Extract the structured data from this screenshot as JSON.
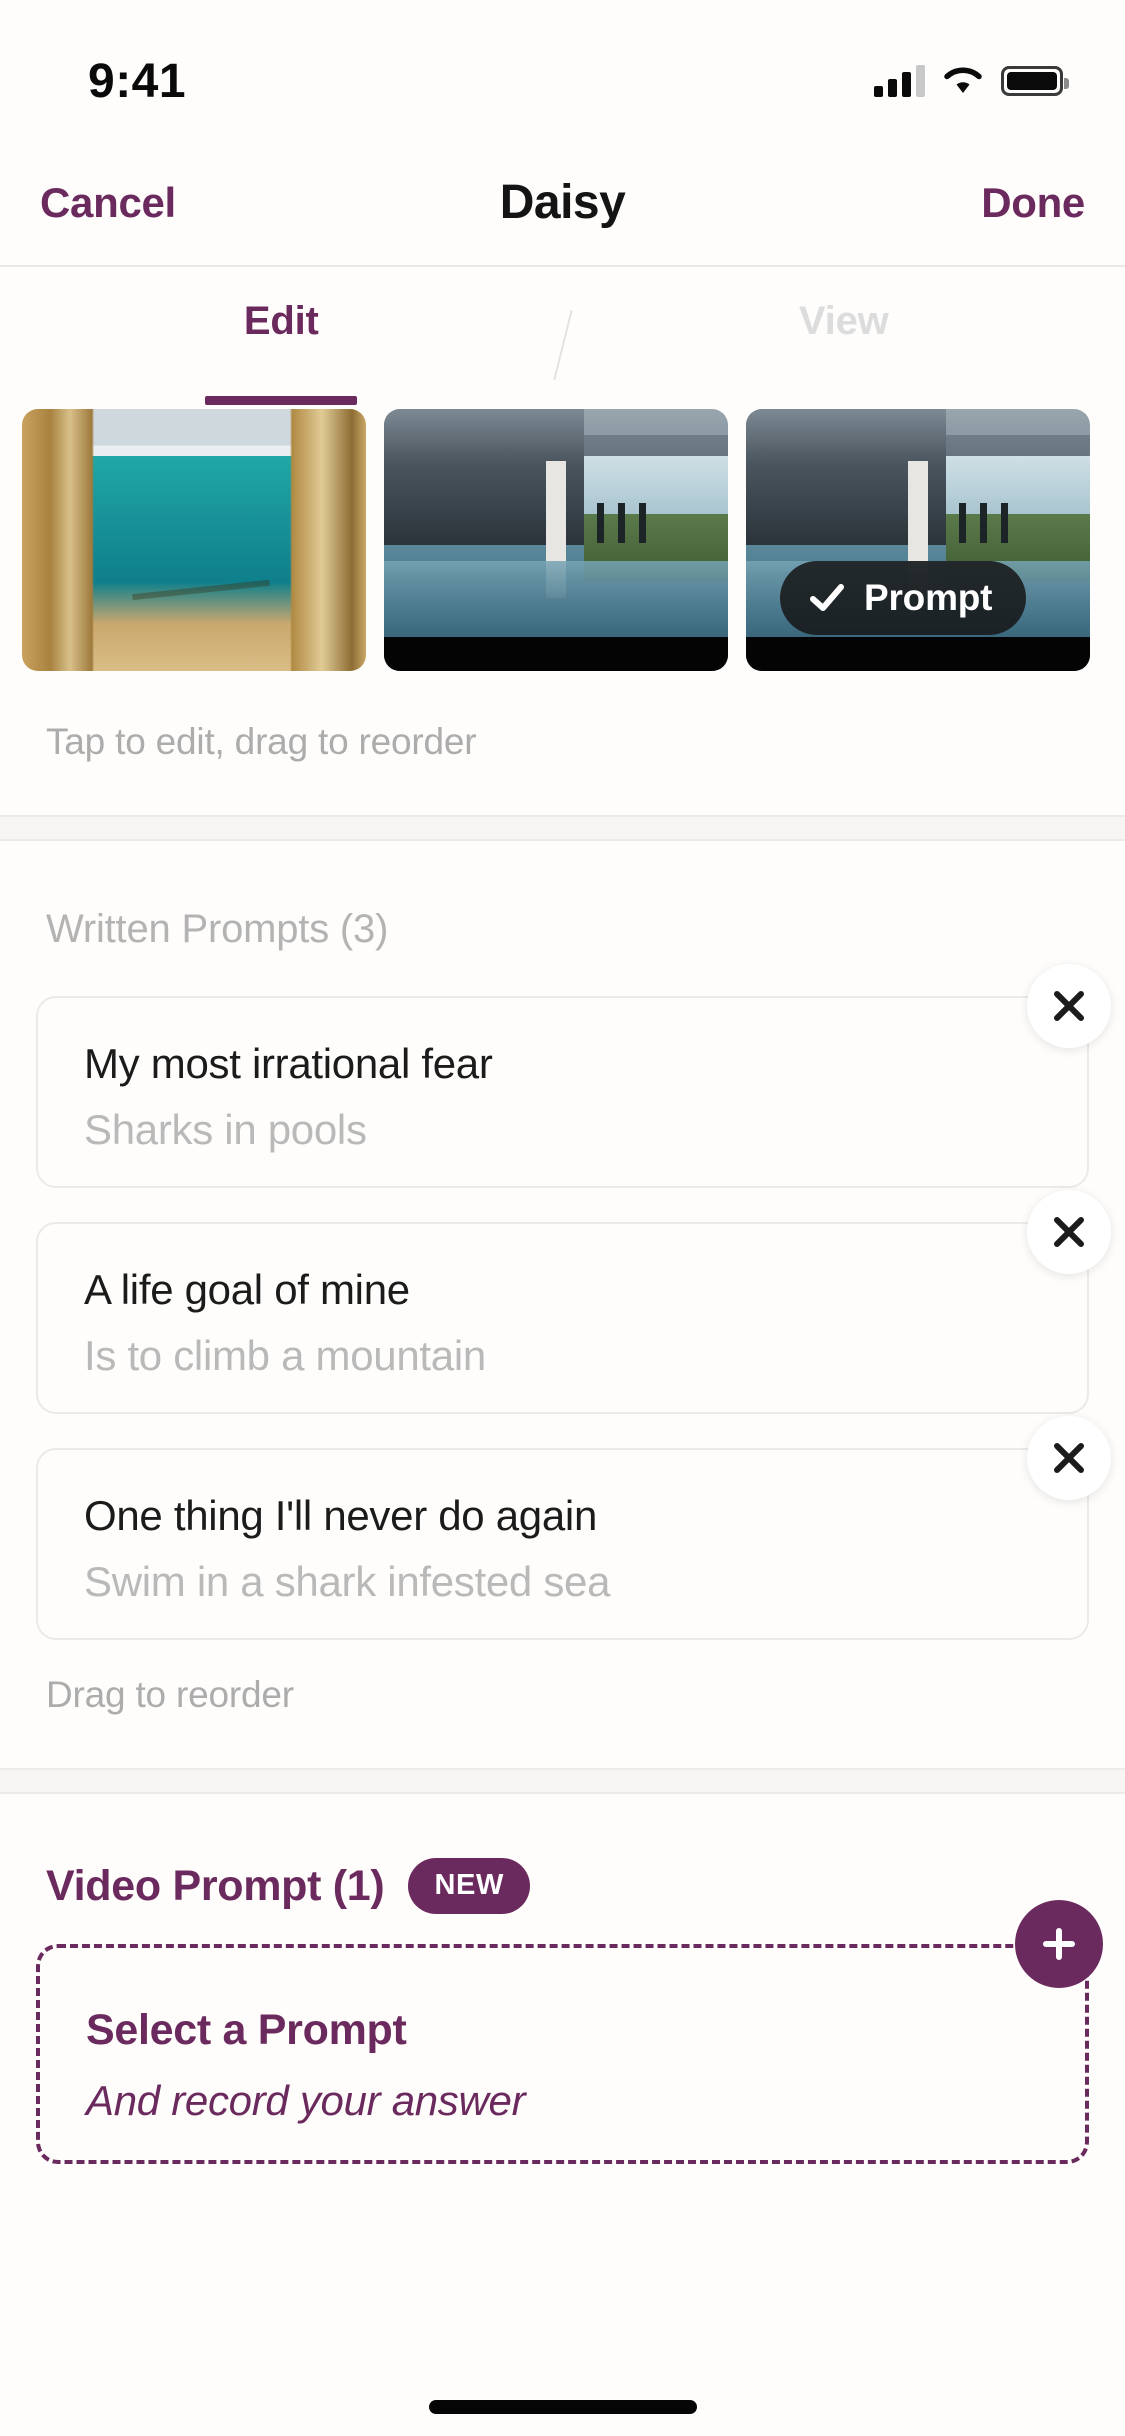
{
  "status_bar": {
    "time": "9:41",
    "cellular_icon": "signal-bars-icon",
    "wifi_icon": "wifi-icon",
    "battery_icon": "battery-icon"
  },
  "nav_bar": {
    "cancel_label": "Cancel",
    "title": "Daisy",
    "done_label": "Done",
    "accent_color": "#6b2a5e"
  },
  "tabs": {
    "items": [
      {
        "label": "Edit",
        "active": true
      },
      {
        "label": "View",
        "active": false
      }
    ]
  },
  "photos": {
    "items": [
      {
        "alt": "Beach between wooden posts",
        "has_prompt_badge": false
      },
      {
        "alt": "Infinity pool terrace",
        "has_prompt_badge": false
      },
      {
        "alt": "Infinity pool terrace",
        "has_prompt_badge": true
      }
    ],
    "badge": {
      "label": "Prompt",
      "check_icon": "check-icon"
    },
    "hint": "Tap to edit, drag to reorder"
  },
  "written_prompts": {
    "section_title": "Written Prompts (3)",
    "hint": "Drag to reorder",
    "close_icon": "close-icon",
    "items": [
      {
        "question": "My most irrational fear",
        "answer": "Sharks in pools"
      },
      {
        "question": "A life goal of mine",
        "answer": "Is to climb a mountain"
      },
      {
        "question": "One thing I'll never do again",
        "answer": "Swim in a shark infested sea"
      }
    ]
  },
  "video_prompt": {
    "section_title": "Video Prompt (1)",
    "new_badge": "NEW",
    "card_title": "Select a Prompt",
    "card_subtitle": "And record your answer",
    "add_icon": "plus-icon",
    "accent_color": "#6b2a5e"
  }
}
